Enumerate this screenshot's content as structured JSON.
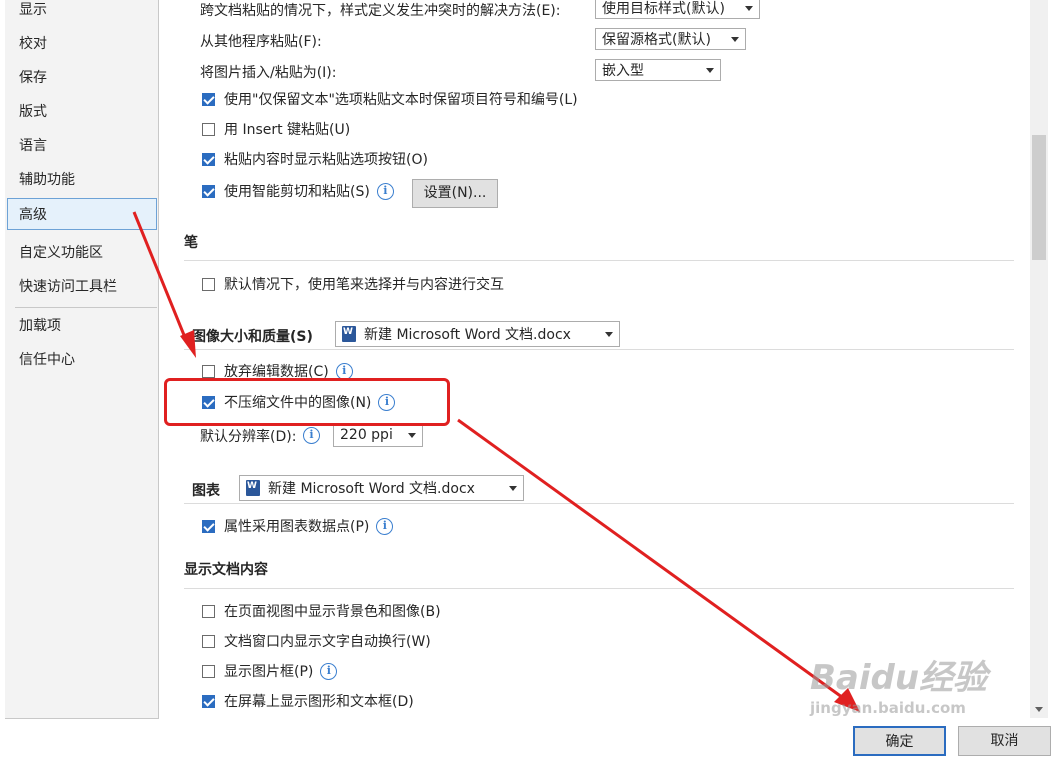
{
  "nav": {
    "items": [
      "显示",
      "校对",
      "保存",
      "版式",
      "语言",
      "辅助功能",
      "高级",
      "自定义功能区",
      "快速访问工具栏",
      "加载项",
      "信任中心"
    ],
    "active": "高级"
  },
  "paste": {
    "conflict_label": "跨文档粘贴的情况下，样式定义发生冲突时的解决方法(E):",
    "conflict_value": "使用目标样式(默认)",
    "other_label": "从其他程序粘贴(F):",
    "other_value": "保留源格式(默认)",
    "picture_label": "将图片插入/粘贴为(I):",
    "picture_value": "嵌入型",
    "keep_bullets": "使用\"仅保留文本\"选项粘贴文本时保留项目符号和编号(L)",
    "insert_key": "用 Insert 键粘贴(U)",
    "show_button": "粘贴内容时显示粘贴选项按钮(O)",
    "smart_cut": "使用智能剪切和粘贴(S)",
    "settings_button": "设置(N)..."
  },
  "pen": {
    "title": "笔",
    "default_pen": "默认情况下，使用笔来选择并与内容进行交互"
  },
  "image": {
    "title": "图像大小和质量(S)",
    "doc": "新建 Microsoft Word 文档.docx",
    "discard": "放弃编辑数据(C)",
    "no_compress": "不压缩文件中的图像(N)",
    "resolution_label": "默认分辨率(D):",
    "resolution_value": "220 ppi"
  },
  "chart": {
    "title": "图表",
    "doc": "新建 Microsoft Word 文档.docx",
    "follow_point": "属性采用图表数据点(P)"
  },
  "display": {
    "title": "显示文档内容",
    "background": "在页面视图中显示背景色和图像(B)",
    "wrap": "文档窗口内显示文字自动换行(W)",
    "placeholders": "显示图片框(P)",
    "drawings": "在屏幕上显示图形和文本框(D)"
  },
  "footer": {
    "ok": "确定",
    "cancel": "取消"
  },
  "watermark": {
    "line1": "Baidu经验",
    "line2": "jingyan.baidu.com"
  },
  "checked": {
    "keep_bullets": true,
    "insert_key": false,
    "show_button": true,
    "smart_cut": true,
    "default_pen": false,
    "discard": false,
    "no_compress": true,
    "follow_point": true,
    "background": false,
    "wrap": false,
    "placeholders": false,
    "drawings": true
  }
}
